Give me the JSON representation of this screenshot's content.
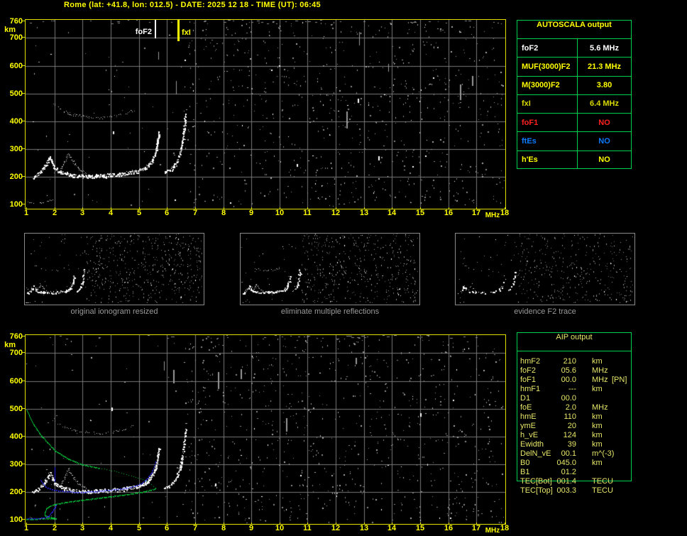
{
  "title": "Rome (lat: +41.8, lon: 012.5) - DATE: 2025 12 18 - TIME (UT): 06:45",
  "colors": {
    "background": "#000000",
    "accent_yellow": "#ffff00",
    "plot_border_yellow": "#e0e000",
    "grid_gray": "#787878",
    "table_border_green": "#00d050",
    "aip_text_yellow": "#e6e668",
    "noise_gray": "#8a8a8a",
    "trace_white": "#ffffff",
    "profile_green": "#00c838",
    "restored_blue": "#2828ff",
    "status_red": "#ff2020",
    "status_blue": "#0a7cff",
    "dim_yellow": "#d8d800",
    "caption_gray": "#9a9a9a"
  },
  "axes": {
    "y_unit": "km",
    "y_ticks": [
      760,
      700,
      600,
      500,
      400,
      300,
      200,
      100
    ],
    "x_unit": "MHz",
    "x_ticks": [
      "1",
      "2",
      "3",
      "4",
      "5",
      "6",
      "7",
      "8",
      "9",
      "10",
      "11",
      "12",
      "13",
      "14",
      "15",
      "16",
      "17",
      "18"
    ],
    "x_range": [
      1,
      18
    ],
    "y_range": [
      100,
      760
    ],
    "grid": true
  },
  "autoscala": {
    "title": "AUTOSCALA output",
    "rows": [
      {
        "label": "foF2",
        "value": "5.6 MHz",
        "color": "#ffffff"
      },
      {
        "label": "MUF(3000)F2",
        "value": "21.3 MHz",
        "color": "#ffff00"
      },
      {
        "label": "M(3000)F2",
        "value": "3.80",
        "color": "#ffff00"
      },
      {
        "label": "fxI",
        "value": "6.4 MHz",
        "color": "#d8d800"
      },
      {
        "label": "foF1",
        "value": "NO",
        "color": "#ff2020"
      },
      {
        "label": "ftEs",
        "value": "NO",
        "color": "#0a7cff"
      },
      {
        "label": "h'Es",
        "value": "NO",
        "color": "#ffff00"
      }
    ]
  },
  "aip": {
    "title": "AIP output",
    "rows": [
      {
        "label": "hmF2",
        "value": "210",
        "unit": "km",
        "extra": ""
      },
      {
        "label": "foF2",
        "value": "05.6",
        "unit": "MHz",
        "extra": ""
      },
      {
        "label": "foF1",
        "value": "00.0",
        "unit": "MHz",
        "extra": "[PN]"
      },
      {
        "label": "hmF1",
        "value": "---",
        "unit": "km",
        "extra": ""
      },
      {
        "label": "D1",
        "value": "00.0",
        "unit": "",
        "extra": ""
      },
      {
        "label": "foE",
        "value": "2.0",
        "unit": "MHz",
        "extra": ""
      },
      {
        "label": "hmE",
        "value": "110",
        "unit": "km",
        "extra": ""
      },
      {
        "label": "ymE",
        "value": "20",
        "unit": "km",
        "extra": ""
      },
      {
        "label": "h_vE",
        "value": "124",
        "unit": "km",
        "extra": ""
      },
      {
        "label": "Ewidth",
        "value": "39",
        "unit": "km",
        "extra": ""
      },
      {
        "label": "DelN_vE",
        "value": "00.1",
        "unit": "m^(-3)",
        "extra": ""
      },
      {
        "label": "B0",
        "value": "045.0",
        "unit": "km",
        "extra": ""
      },
      {
        "label": "B1",
        "value": "01.2",
        "unit": "",
        "extra": ""
      },
      {
        "label": "TEC[Bot]",
        "value": "001.4",
        "unit": "TECU",
        "extra": ""
      },
      {
        "label": "TEC[Top]",
        "value": "003.3",
        "unit": "TECU",
        "extra": ""
      }
    ]
  },
  "chart_data": {
    "type": "scatter",
    "title": "ionogram virtual height vs frequency",
    "xlabel": "MHz",
    "ylabel": "km",
    "xlim": [
      1,
      18
    ],
    "ylim": [
      100,
      760
    ],
    "echo_traces": [
      {
        "name": "E-F-left-tail",
        "points": [
          [
            1.22,
            198
          ],
          [
            1.45,
            212
          ],
          [
            1.65,
            238
          ],
          [
            1.83,
            268
          ]
        ],
        "w": 2.5,
        "density": 1.5,
        "style": "white"
      },
      {
        "name": "F-trace-main",
        "points": [
          [
            1.83,
            268
          ],
          [
            2.0,
            232
          ],
          [
            2.25,
            214
          ],
          [
            2.7,
            206
          ],
          [
            3.2,
            203
          ],
          [
            3.8,
            205
          ],
          [
            4.4,
            210
          ],
          [
            4.9,
            219
          ],
          [
            5.2,
            231
          ],
          [
            5.45,
            253
          ],
          [
            5.58,
            290
          ],
          [
            5.66,
            328
          ],
          [
            5.71,
            360
          ]
        ],
        "w": 3,
        "density": 1.9,
        "style": "white"
      },
      {
        "name": "F1-cusp",
        "points": [
          [
            2.2,
            226
          ],
          [
            2.35,
            252
          ],
          [
            2.5,
            282
          ],
          [
            2.66,
            254
          ],
          [
            2.88,
            227
          ],
          [
            3.15,
            211
          ]
        ],
        "w": 2,
        "density": 1.0,
        "style": "gray"
      },
      {
        "name": "x-mode-rise",
        "points": [
          [
            5.9,
            214
          ],
          [
            6.1,
            224
          ],
          [
            6.3,
            247
          ],
          [
            6.45,
            282
          ],
          [
            6.55,
            332
          ],
          [
            6.62,
            392
          ],
          [
            6.65,
            428
          ]
        ],
        "w": 2.5,
        "density": 1.4,
        "style": "white"
      },
      {
        "name": "second-hop-arc",
        "points": [
          [
            1.95,
            462
          ],
          [
            2.2,
            442
          ],
          [
            2.6,
            426
          ],
          [
            3.1,
            416
          ],
          [
            3.6,
            412
          ],
          [
            4.1,
            417
          ],
          [
            4.5,
            428
          ],
          [
            4.8,
            441
          ]
        ],
        "w": 2,
        "density": 0.5,
        "style": "gray"
      },
      {
        "name": "E-echo",
        "points": [
          [
            1.05,
            107
          ],
          [
            1.4,
            104
          ],
          [
            1.7,
            109
          ],
          [
            1.9,
            118
          ]
        ],
        "w": 1.5,
        "density": 0.4,
        "style": "gray"
      }
    ],
    "plots": [
      {
        "id": "top",
        "markers": [
          {
            "label": "foF2",
            "freq_mhz": 5.6,
            "color": "#ffffff",
            "line_h": 26,
            "label_side": "left"
          },
          {
            "label": "fxI",
            "freq_mhz": 6.4,
            "color": "#ffff00",
            "line_h": 30,
            "label_side": "right"
          }
        ],
        "noise": {
          "seed": 77,
          "sparse": 55,
          "dense": 820,
          "dense_from_mhz": 6.6,
          "top_dashes": 46,
          "streaks": 7,
          "blobs": 4
        }
      },
      {
        "id": "bottom",
        "noise": {
          "seed": 991,
          "sparse": 60,
          "dense": 840,
          "dense_from_mhz": 6.6,
          "top_dashes": 42,
          "streaks": 6,
          "blobs": 3
        },
        "profile_green": {
          "topside": [
            [
              1.0,
              497
            ],
            [
              1.2,
              452
            ],
            [
              1.5,
              406
            ],
            [
              2.0,
              350
            ],
            [
              2.5,
              320
            ],
            [
              3.0,
              300
            ],
            [
              3.6,
              288
            ],
            [
              4.2,
              273
            ],
            [
              4.8,
              257
            ],
            [
              5.2,
              243
            ],
            [
              5.45,
              229
            ],
            [
              5.6,
              215
            ]
          ],
          "dotted_from_mhz": 3.4,
          "bottomside": [
            [
              5.6,
              212
            ],
            [
              5.2,
              202
            ],
            [
              4.6,
              192
            ],
            [
              3.8,
              181
            ],
            [
              3.0,
              171
            ],
            [
              2.4,
              163
            ],
            [
              2.0,
              156
            ],
            [
              1.8,
              149
            ],
            [
              1.7,
              141
            ],
            [
              1.66,
              129
            ],
            [
              1.66,
              119
            ],
            [
              1.73,
              112
            ],
            [
              1.95,
              108
            ],
            [
              2.05,
              106
            ],
            [
              1.6,
              104
            ],
            [
              1.2,
              102
            ],
            [
              1.0,
              102
            ]
          ]
        },
        "restored_trace_blue": [
          {
            "points": [
              [
                1.5,
                242
              ],
              [
                1.7,
                218
              ],
              [
                2.0,
                208
              ],
              [
                2.4,
                202
              ],
              [
                2.9,
                200
              ],
              [
                3.4,
                203
              ],
              [
                3.9,
                208
              ],
              [
                4.4,
                213
              ],
              [
                4.8,
                220
              ],
              [
                5.1,
                232
              ],
              [
                5.3,
                248
              ],
              [
                5.45,
                268
              ],
              [
                5.55,
                292
              ],
              [
                5.6,
                310
              ]
            ]
          },
          {
            "points": [
              [
                2.0,
                238
              ],
              [
                2.0,
                290
              ]
            ]
          },
          {
            "points": [
              [
                1.02,
                104
              ],
              [
                1.35,
                104
              ],
              [
                1.6,
                107
              ],
              [
                1.78,
                114
              ],
              [
                1.92,
                128
              ],
              [
                2.0,
                143
              ],
              [
                2.05,
                155
              ]
            ]
          }
        ]
      }
    ],
    "thumbnails": [
      {
        "caption": "original ionogram resized",
        "trace_keep": 1.0,
        "noise_seed": 5,
        "dense": 520,
        "sparse": 40,
        "bright": 0.5
      },
      {
        "caption": "eliminate multiple reflections",
        "trace_keep": 0.9,
        "noise_seed": 23,
        "dense": 460,
        "sparse": 34,
        "bright": 0.5
      },
      {
        "caption": "evidence F2 trace",
        "trace_keep": 0.45,
        "noise_seed": 51,
        "dense": 380,
        "sparse": 30,
        "bright": 0.25
      }
    ]
  }
}
